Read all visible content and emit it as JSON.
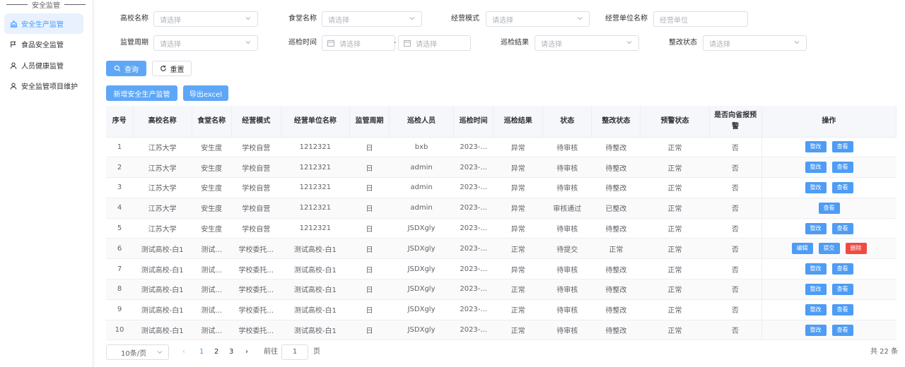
{
  "sidebar": {
    "title": "安全监管",
    "items": [
      {
        "label": "安全生产监管",
        "icon": "building-icon",
        "active": true
      },
      {
        "label": "食品安全监管",
        "icon": "flag-icon",
        "active": false
      },
      {
        "label": "人员健康监管",
        "icon": "user-icon",
        "active": false
      },
      {
        "label": "安全监管项目维护",
        "icon": "user-icon",
        "active": false
      }
    ]
  },
  "filters": {
    "school_label": "高校名称",
    "school_placeholder": "请选择",
    "canteen_label": "食堂名称",
    "canteen_placeholder": "请选择",
    "mode_label": "经营模式",
    "mode_placeholder": "请选择",
    "unit_label": "经营单位名称",
    "unit_placeholder": "经营单位",
    "period_label": "监管周期",
    "period_placeholder": "请选择",
    "time_label": "巡检时间",
    "time_start_placeholder": "请选择",
    "time_end_placeholder": "请选择",
    "time_separator": "-",
    "result_label": "巡检结果",
    "result_placeholder": "请选择",
    "rectify_label": "整改状态",
    "rectify_placeholder": "请选择"
  },
  "actions": {
    "query": "查询",
    "reset": "重置",
    "add": "新增安全生产监管",
    "export": "导出excel"
  },
  "table": {
    "headers": [
      "序号",
      "高校名称",
      "食堂名称",
      "经营模式",
      "经营单位名称",
      "监管周期",
      "巡检人员",
      "巡检时间",
      "巡检结果",
      "状态",
      "整改状态",
      "预警状态",
      "是否向省报预警",
      "操作"
    ],
    "rows": [
      {
        "no": "1",
        "school": "江苏大学",
        "canteen": "安生度",
        "mode": "学校自营",
        "unit": "1212321",
        "period": "日",
        "inspector": "bxb",
        "time": "2023-...",
        "result": "异常",
        "status": "待审核",
        "rectify": "待整改",
        "warn": "正常",
        "report": "否",
        "ops": [
          "整改",
          "查看"
        ]
      },
      {
        "no": "2",
        "school": "江苏大学",
        "canteen": "安生度",
        "mode": "学校自营",
        "unit": "1212321",
        "period": "日",
        "inspector": "admin",
        "time": "2023-...",
        "result": "异常",
        "status": "待审核",
        "rectify": "待整改",
        "warn": "正常",
        "report": "否",
        "ops": [
          "整改",
          "查看"
        ]
      },
      {
        "no": "3",
        "school": "江苏大学",
        "canteen": "安生度",
        "mode": "学校自营",
        "unit": "1212321",
        "period": "日",
        "inspector": "admin",
        "time": "2023-...",
        "result": "异常",
        "status": "待审核",
        "rectify": "待整改",
        "warn": "正常",
        "report": "否",
        "ops": [
          "整改",
          "查看"
        ]
      },
      {
        "no": "4",
        "school": "江苏大学",
        "canteen": "安生度",
        "mode": "学校自营",
        "unit": "1212321",
        "period": "日",
        "inspector": "admin",
        "time": "2023-...",
        "result": "异常",
        "status": "审核通过",
        "rectify": "已整改",
        "warn": "正常",
        "report": "否",
        "ops": [
          "查看"
        ]
      },
      {
        "no": "5",
        "school": "江苏大学",
        "canteen": "安生度",
        "mode": "学校自营",
        "unit": "1212321",
        "period": "日",
        "inspector": "JSDXgly",
        "time": "2023-...",
        "result": "异常",
        "status": "待审核",
        "rectify": "待整改",
        "warn": "正常",
        "report": "否",
        "ops": [
          "整改",
          "查看"
        ]
      },
      {
        "no": "6",
        "school": "测试高校-白1",
        "canteen": "测试...",
        "mode": "学校委托...",
        "unit": "测试高校-白1",
        "period": "日",
        "inspector": "JSDXgly",
        "time": "2023-...",
        "result": "正常",
        "status": "待提交",
        "rectify": "正常",
        "warn": "正常",
        "report": "否",
        "ops": [
          "编辑",
          "提交",
          "删除"
        ]
      },
      {
        "no": "7",
        "school": "测试高校-白1",
        "canteen": "测试...",
        "mode": "学校委托...",
        "unit": "测试高校-白1",
        "period": "日",
        "inspector": "JSDXgly",
        "time": "2023-...",
        "result": "异常",
        "status": "待审核",
        "rectify": "待整改",
        "warn": "正常",
        "report": "否",
        "ops": [
          "整改",
          "查看"
        ]
      },
      {
        "no": "8",
        "school": "测试高校-白1",
        "canteen": "测试...",
        "mode": "学校委托...",
        "unit": "测试高校-白1",
        "period": "日",
        "inspector": "JSDXgly",
        "time": "2023-...",
        "result": "正常",
        "status": "待审核",
        "rectify": "待整改",
        "warn": "正常",
        "report": "否",
        "ops": [
          "整改",
          "查看"
        ]
      },
      {
        "no": "9",
        "school": "测试高校-白1",
        "canteen": "测试...",
        "mode": "学校委托...",
        "unit": "测试高校-白1",
        "period": "日",
        "inspector": "JSDXgly",
        "time": "2023-...",
        "result": "正常",
        "status": "待审核",
        "rectify": "待整改",
        "warn": "正常",
        "report": "否",
        "ops": [
          "整改",
          "查看"
        ]
      },
      {
        "no": "10",
        "school": "测试高校-白1",
        "canteen": "测试...",
        "mode": "学校委托...",
        "unit": "测试高校-白1",
        "period": "日",
        "inspector": "JSDXgly",
        "time": "2023-...",
        "result": "正常",
        "status": "待审核",
        "rectify": "待整改",
        "warn": "正常",
        "report": "否",
        "ops": [
          "整改",
          "查看"
        ]
      }
    ]
  },
  "pagination": {
    "page_size": "10条/页",
    "pages": [
      "1",
      "2",
      "3"
    ],
    "current": "1",
    "goto_label": "前往",
    "goto_value": "1",
    "page_unit": "页",
    "total": "共 22 条"
  },
  "colors": {
    "primary": "#409eff",
    "button": "#5ea7f7",
    "danger": "#f04a43"
  }
}
